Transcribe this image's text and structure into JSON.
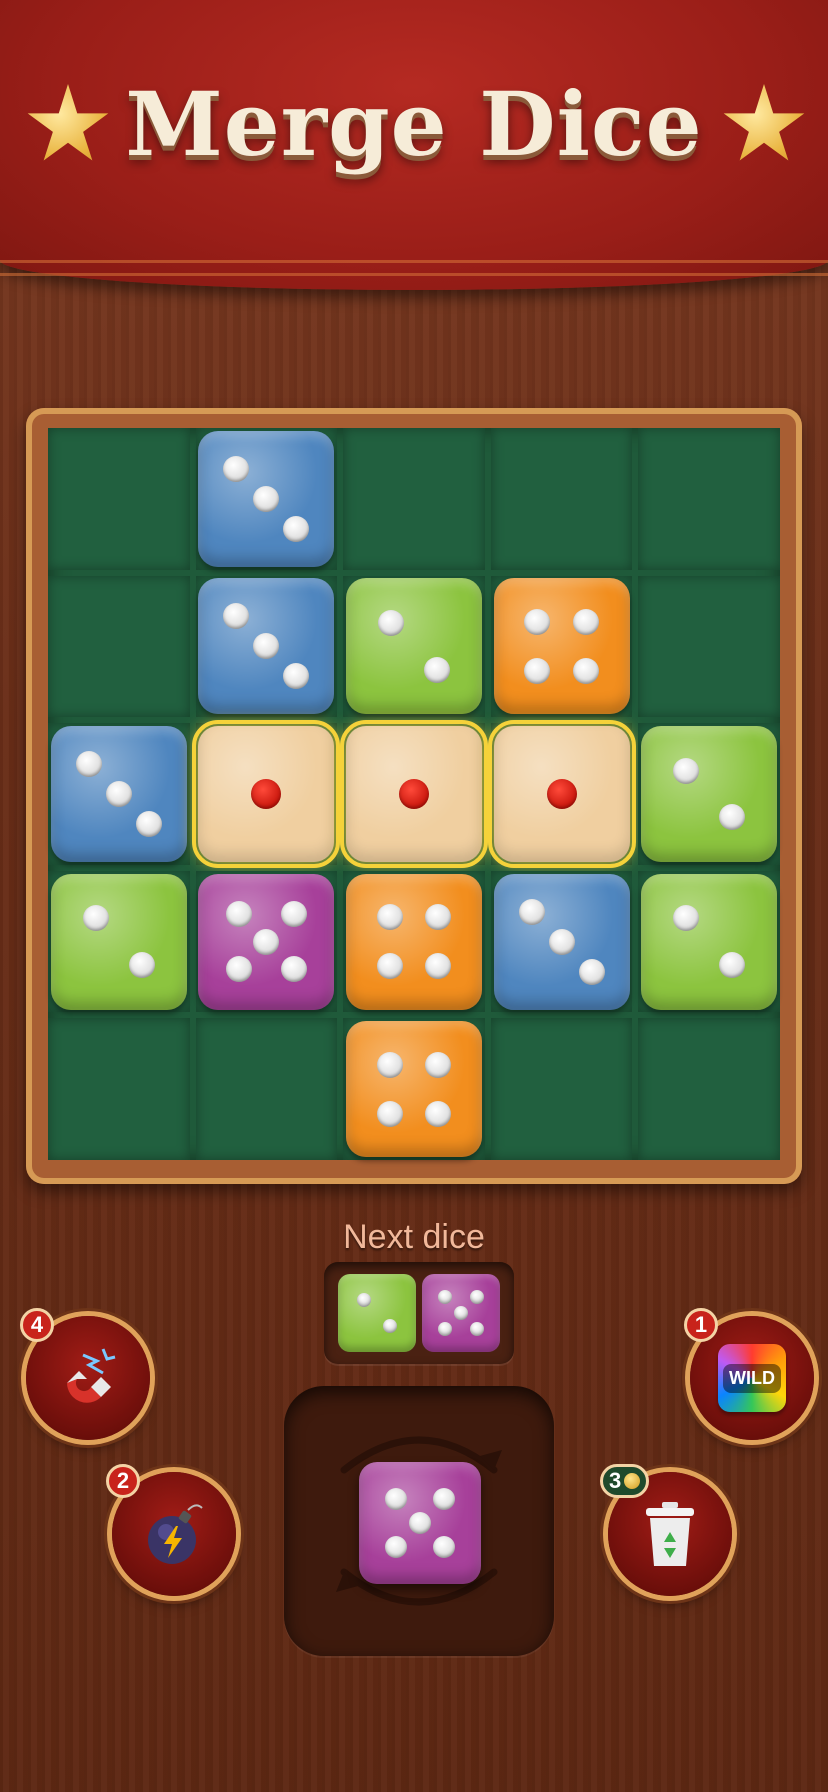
{
  "header": {
    "title": "Merge Dice"
  },
  "colors": {
    "blue": "#4f86bf",
    "green": "#8cc43f",
    "orange": "#f28e1e",
    "purple": "#a7409a",
    "wood": "#f0cfa0"
  },
  "board": {
    "rows": [
      [
        null,
        {
          "color": "blue",
          "value": 3
        },
        null,
        null,
        null
      ],
      [
        null,
        {
          "color": "blue",
          "value": 3
        },
        {
          "color": "green",
          "value": 2
        },
        {
          "color": "orange",
          "value": 4
        },
        null
      ],
      [
        {
          "color": "blue",
          "value": 3
        },
        {
          "color": "wood",
          "value": 1,
          "highlight": true
        },
        {
          "color": "wood",
          "value": 1,
          "highlight": true
        },
        {
          "color": "wood",
          "value": 1,
          "highlight": true
        },
        {
          "color": "green",
          "value": 2
        }
      ],
      [
        {
          "color": "green",
          "value": 2
        },
        {
          "color": "purple",
          "value": 5
        },
        {
          "color": "orange",
          "value": 4
        },
        {
          "color": "blue",
          "value": 3
        },
        {
          "color": "green",
          "value": 2
        }
      ],
      [
        null,
        null,
        {
          "color": "orange",
          "value": 4
        },
        null,
        null
      ]
    ]
  },
  "next": {
    "label": "Next dice",
    "dice": [
      {
        "color": "green",
        "value": 2
      },
      {
        "color": "purple",
        "value": 5
      }
    ]
  },
  "current": {
    "color": "purple",
    "value": 5,
    "rotate_icon": "rotate-arrows-icon"
  },
  "powerups": {
    "magnet": {
      "count": "4",
      "icon": "magnet-icon"
    },
    "bomb": {
      "count": "2",
      "icon": "bomb-icon"
    },
    "wild": {
      "count": "1",
      "label": "WILD",
      "icon": "wild-icon"
    },
    "trash": {
      "count": "3",
      "icon": "trash-icon"
    }
  }
}
